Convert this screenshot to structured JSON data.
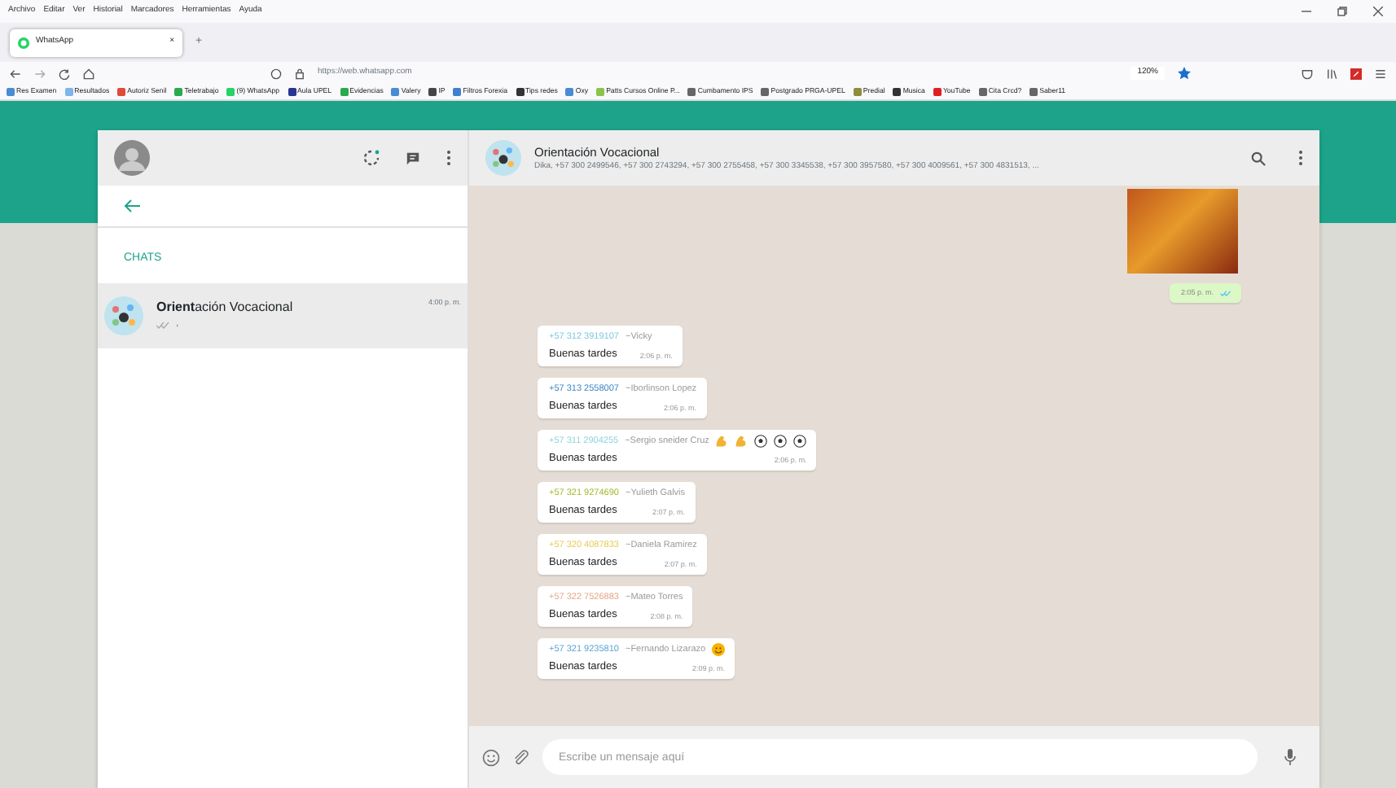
{
  "browser": {
    "menu": [
      "Archivo",
      "Editar",
      "Ver",
      "Historial",
      "Marcadores",
      "Herramientas",
      "Ayuda"
    ],
    "tab": {
      "title": "WhatsApp",
      "close": "×"
    },
    "new_tab": "+",
    "url": "https://web.whatsapp.com",
    "zoom": "120%",
    "bookmarks": [
      "Res Examen",
      "Resultados",
      "Autoriz Senil",
      "Teletrabajo",
      "(9) WhatsApp",
      "Aula UPEL",
      "Evidencias",
      "Valery",
      "IP",
      "Filtros Forexia",
      "Tips redes",
      "Oxy",
      "Patts Cursos Online P...",
      "Cumbamento IPS",
      "Postgrado PRGA-UPEL",
      "Predial",
      "Musica",
      "YouTube",
      "Cita Crcd?",
      "Saber11"
    ]
  },
  "sidebar": {
    "title": "CHATS",
    "chats": [
      {
        "name": "**Orient**ación Vocacional",
        "time": "4:00 p. m.",
        "preview": ",",
        "selected": true
      }
    ]
  },
  "chat": {
    "title": "Orientación Vocacional",
    "subtitle": "Dika, +57 300 2499546, +57 300 2743294, +57 300 2755458, +57 300 3345538, +57 300 3957580, +57 300 4009561, +57 300 4831513, ...",
    "outgoing": {
      "time": "2:05 p. m."
    },
    "messages": [
      {
        "phone": "+57 312 3919107",
        "name": "~Vicky",
        "text": "Buenas tardes",
        "time": "2:06 p. m.",
        "color": "#7fc6e0",
        "kind": "plain"
      },
      {
        "phone": "+57 313 2558007",
        "name": "~Iborlinson Lopez",
        "text": "Buenas  tardes",
        "time": "2:06 p. m.",
        "color": "#3d86c6",
        "kind": "plain"
      },
      {
        "phone": "+57 311 2904255",
        "name": "~Sergio sneider Cruz",
        "text": "Buenas tardes",
        "time": "2:06 p. m.",
        "color": "#8fd3dc",
        "kind": "sporty"
      },
      {
        "phone": "+57 321 9274690",
        "name": "~Yulieth Galvis",
        "text": "Buenas tardes",
        "time": "2:07 p. m.",
        "color": "#a3b82c",
        "kind": "plain"
      },
      {
        "phone": "+57 320 4087833",
        "name": "~Daniela Ramirez",
        "text": "Buenas tardes",
        "time": "2:07 p. m.",
        "color": "#e6cc55",
        "kind": "plain"
      },
      {
        "phone": "+57 322 7526883",
        "name": "~Mateo Torres",
        "text": "Buenas tardes",
        "time": "2:08 p. m.",
        "color": "#e3a98a",
        "kind": "plain"
      },
      {
        "phone": "+57 321 9235810",
        "name": "~Fernando Lizarazo",
        "text": "Buenas tardes",
        "time": "2:09 p. m.",
        "color": "#5ea3d6",
        "kind": "smiley"
      }
    ],
    "composer": {
      "placeholder": "Escribe un mensaje aquí"
    }
  }
}
